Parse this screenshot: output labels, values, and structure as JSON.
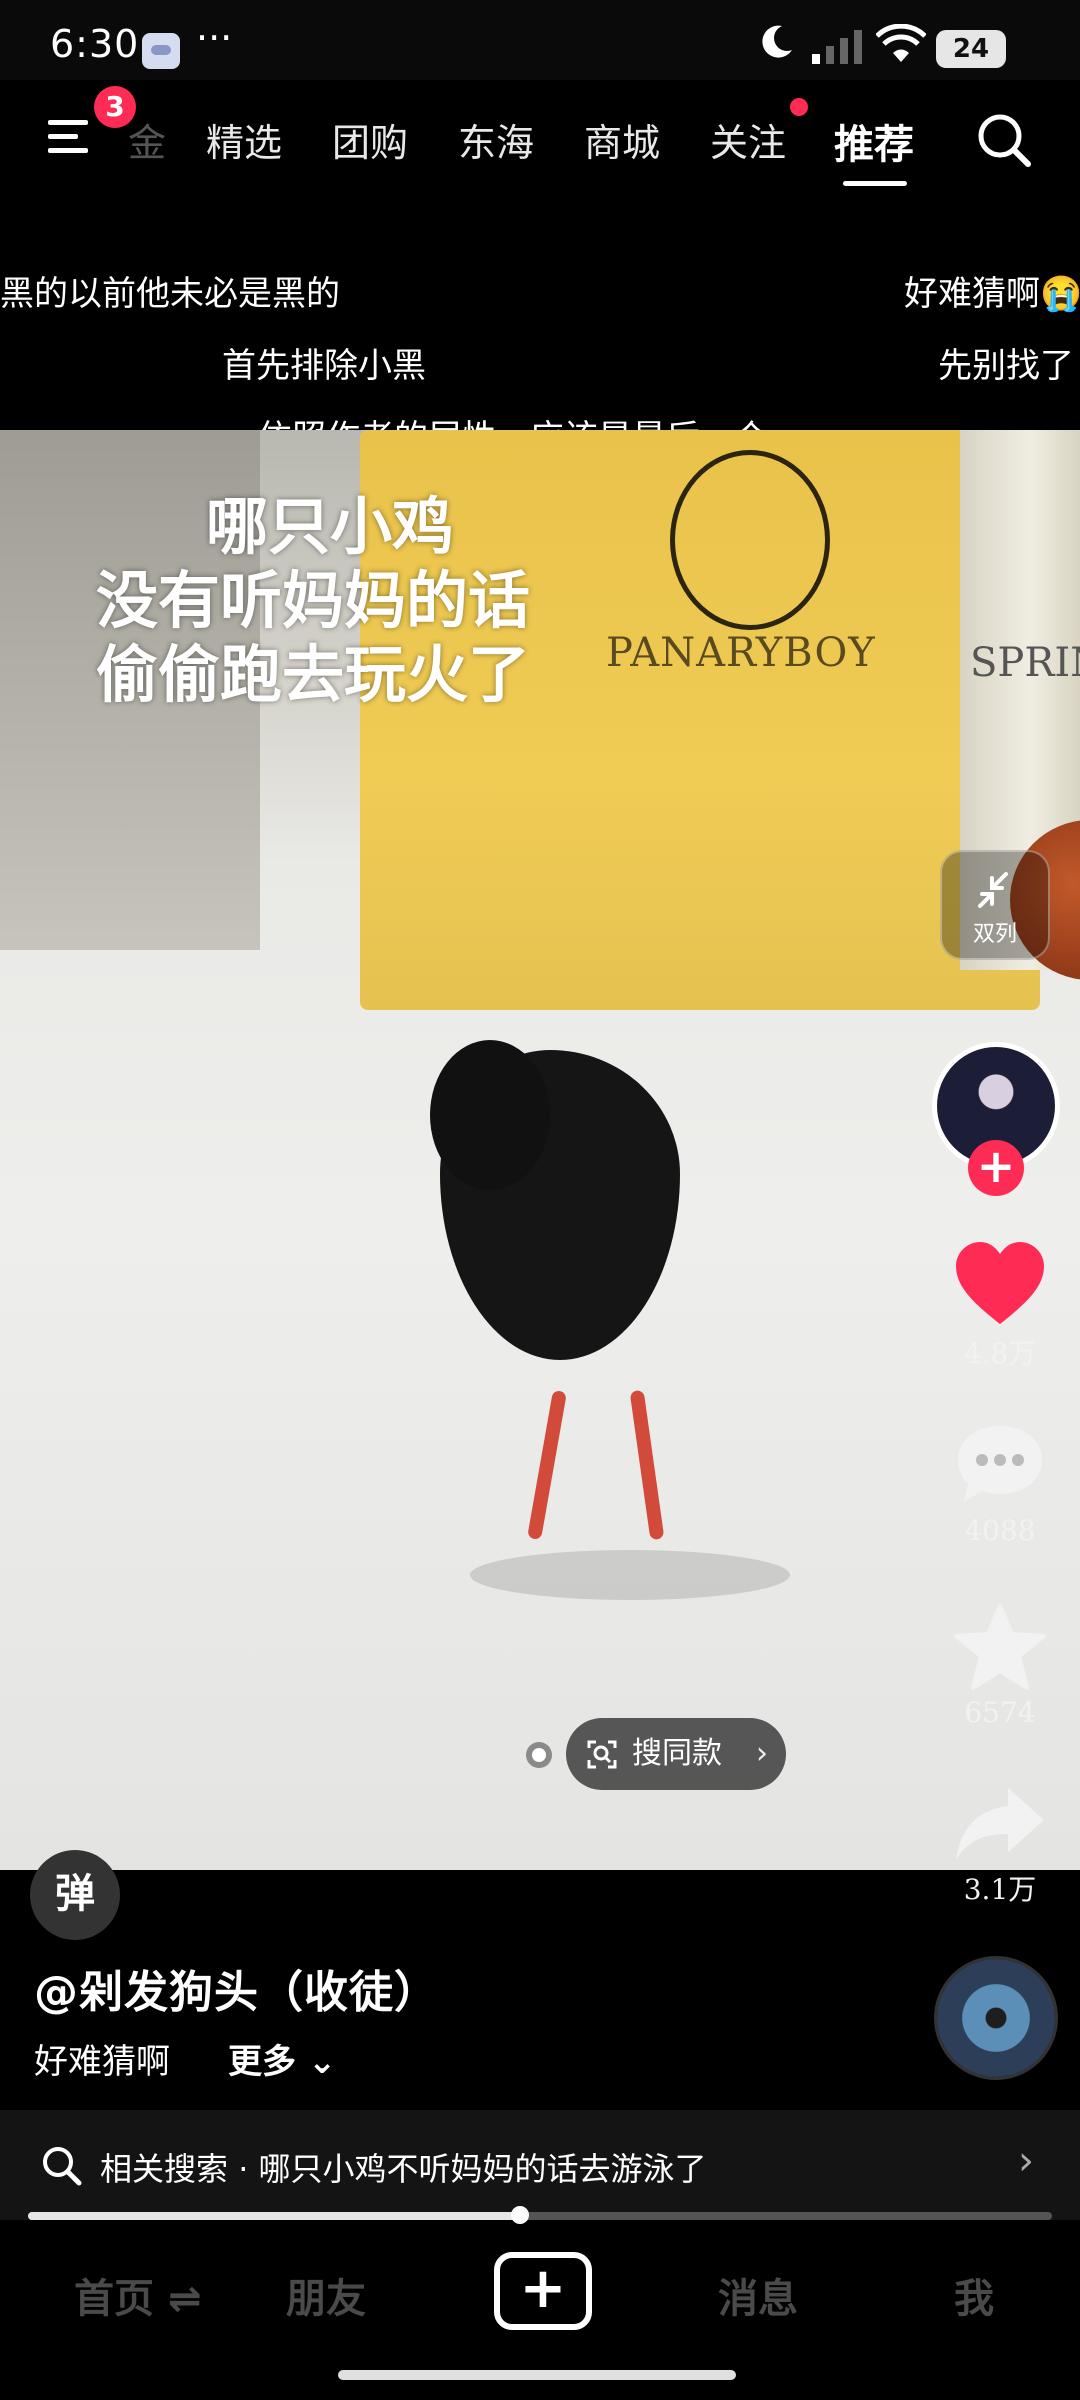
{
  "status_bar": {
    "time": "6:30",
    "dots": "···",
    "battery": "24"
  },
  "top_nav": {
    "badge_count": "3",
    "tabs": [
      "金",
      "精选",
      "团购",
      "东海",
      "商城",
      "关注",
      "推荐"
    ],
    "active_tab": "推荐"
  },
  "danmaku": [
    "黑的以前他未必是黑的",
    "好难猜啊😭",
    "首先排除小黑",
    "先别找了",
    "依照作者的尿性，应该是最后一个"
  ],
  "video": {
    "caption_lines": [
      "哪只小鸡",
      "没有听妈妈的话",
      "偷偷跑去玩火了"
    ],
    "bag_text": "PANARYBOY",
    "jar_text": "SPRIN",
    "product_search_label": "搜同款"
  },
  "side_actions": {
    "split_label": "双列",
    "likes": "4.8万",
    "comments": "4088",
    "favorites": "6574",
    "shares": "3.1万"
  },
  "info": {
    "danmu_toggle": "弹",
    "author": "@剁发狗头（收徒）",
    "description": "好难猜啊",
    "more": "更多"
  },
  "related_search": {
    "prefix": "相关搜索",
    "query": "哪只小鸡不听妈妈的话去游泳了"
  },
  "progress": {
    "fraction": 0.48
  },
  "bottom_nav": {
    "home": "首页",
    "home_suffix": "⇌",
    "friends": "朋友",
    "messages": "消息",
    "me": "我"
  },
  "colors": {
    "accent": "#fe2c55",
    "background": "#000000",
    "bag_yellow": "#f0cc55"
  }
}
